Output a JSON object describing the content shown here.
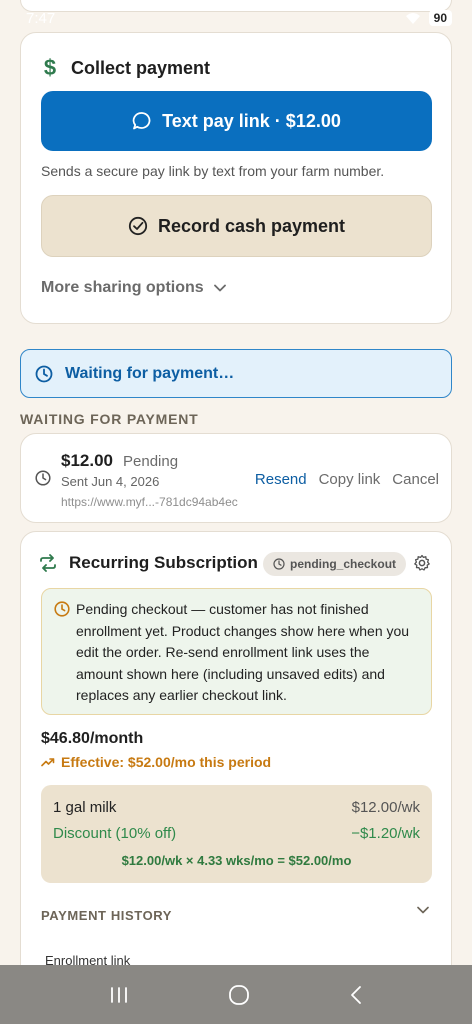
{
  "status": {
    "time": "7:47",
    "battery": "90"
  },
  "collect": {
    "title": "Collect payment",
    "text_pay_label": "Text pay link · $12.00",
    "note": "Sends a secure pay link by text from your farm number.",
    "record_cash_label": "Record cash payment",
    "more_sharing_label": "More sharing options"
  },
  "banner": {
    "text": "Waiting for payment…"
  },
  "waiting_section": {
    "label": "WAITING FOR PAYMENT"
  },
  "pending": {
    "amount": "$12.00",
    "status": "Pending",
    "sent": "Sent Jun 4, 2026",
    "url": "https://www.myf...-781dc94ab4ec",
    "actions": {
      "resend": "Resend",
      "copy": "Copy link",
      "cancel": "Cancel"
    }
  },
  "subscription": {
    "title": "Recurring Subscription",
    "badge": "pending_checkout",
    "note": "Pending checkout — customer has not finished enrollment yet. Product changes show here when you edit the order. Re-send enrollment link uses the amount shown here (including unsaved edits) and replaces any earlier checkout link.",
    "price": "$46.80/month",
    "effective": "Effective: $52.00/mo this period",
    "breakdown": {
      "item_name": "1 gal milk",
      "item_value": "$12.00/wk",
      "discount_name": "Discount (10% off)",
      "discount_value": "−$1.20/wk",
      "formula": "$12.00/wk × 4.33 wks/mo = $52.00/mo"
    },
    "history_label": "PAYMENT HISTORY",
    "enrollment_label": "Enrollment link"
  },
  "colors": {
    "primary": "#0a6fbf",
    "accent_green": "#2f8a4b",
    "warning": "#c77a12",
    "background": "#f8f3ec"
  }
}
